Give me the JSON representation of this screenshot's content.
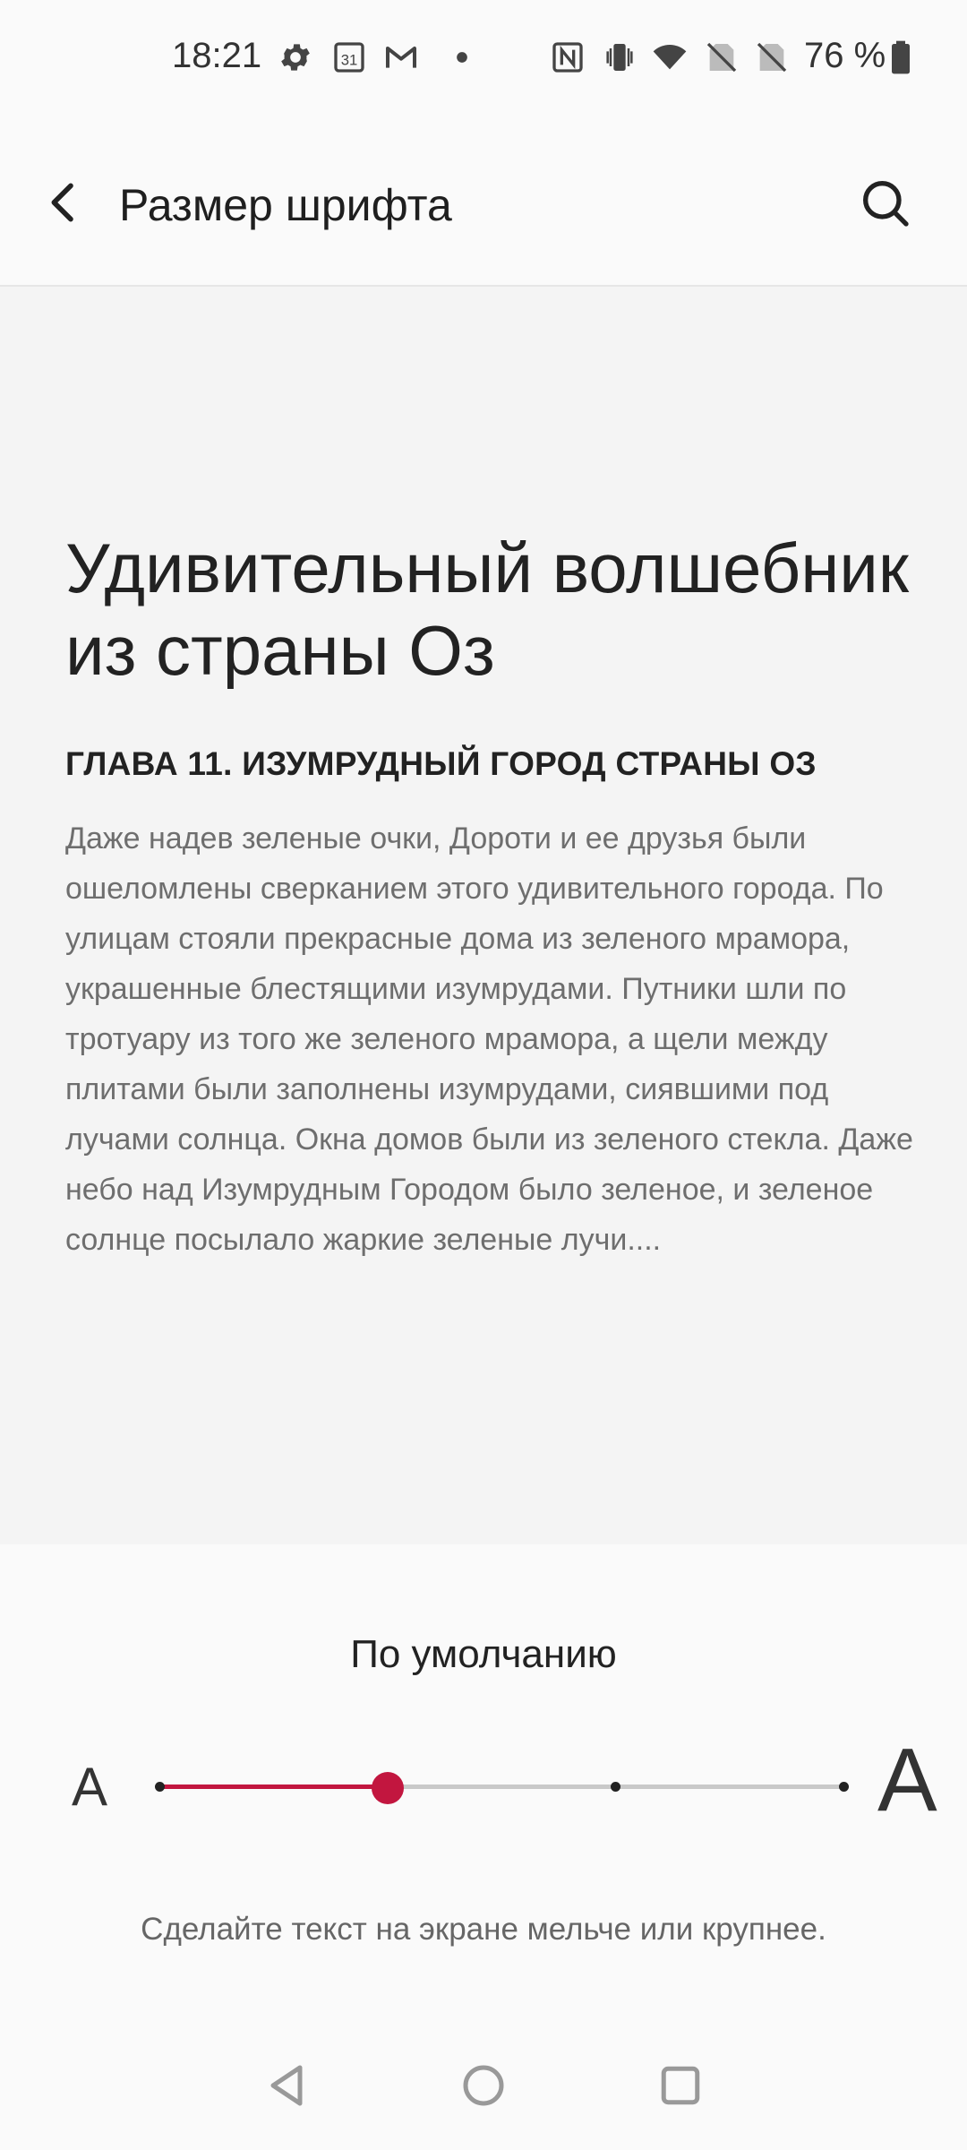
{
  "status_bar": {
    "time": "18:21",
    "calendar_day": "31",
    "battery": "76 %",
    "icons": [
      "settings-icon",
      "calendar-icon",
      "gmail-icon",
      "dot-icon",
      "nfc-icon",
      "vibrate-icon",
      "wifi-icon",
      "no-sim-icon",
      "no-sim-icon",
      "battery-icon"
    ]
  },
  "app_bar": {
    "title": "Размер шрифта",
    "back_icon": "back-arrow-icon",
    "search_icon": "search-icon"
  },
  "preview": {
    "book_title": "Удивительный волшебник из страны Оз",
    "chapter": "ГЛАВА 11. ИЗУМРУДНЫЙ ГОРОД СТРАНЫ ОЗ",
    "text": "Даже надев зеленые очки, Дороти и ее друзья были ошеломлены сверканием этого удивительного города. По улицам стояли прекрасные дома из зеленого мрамора, украшенные блестящими изумрудами. Путники шли по тротуару из того же зеленого мрамора, а щели между плитами были заполнены изумрудами, сиявшими под лучами солнца. Окна домов были из зеленого стекла. Даже небо над Изумрудным Городом было зеленое, и зеленое солнце посылало жаркие зеленые лучи...."
  },
  "font_size": {
    "label": "По умолчанию",
    "small_letter": "A",
    "large_letter": "A",
    "steps": 4,
    "selected_index": 1,
    "hint": "Сделайте текст на экране мельче или крупнее."
  },
  "colors": {
    "accent": "#c2163f",
    "background": "#fafafa",
    "preview_background": "#f4f4f4"
  },
  "nav_bar": {
    "icons": [
      "back-triangle-icon",
      "home-circle-icon",
      "recents-square-icon"
    ]
  }
}
